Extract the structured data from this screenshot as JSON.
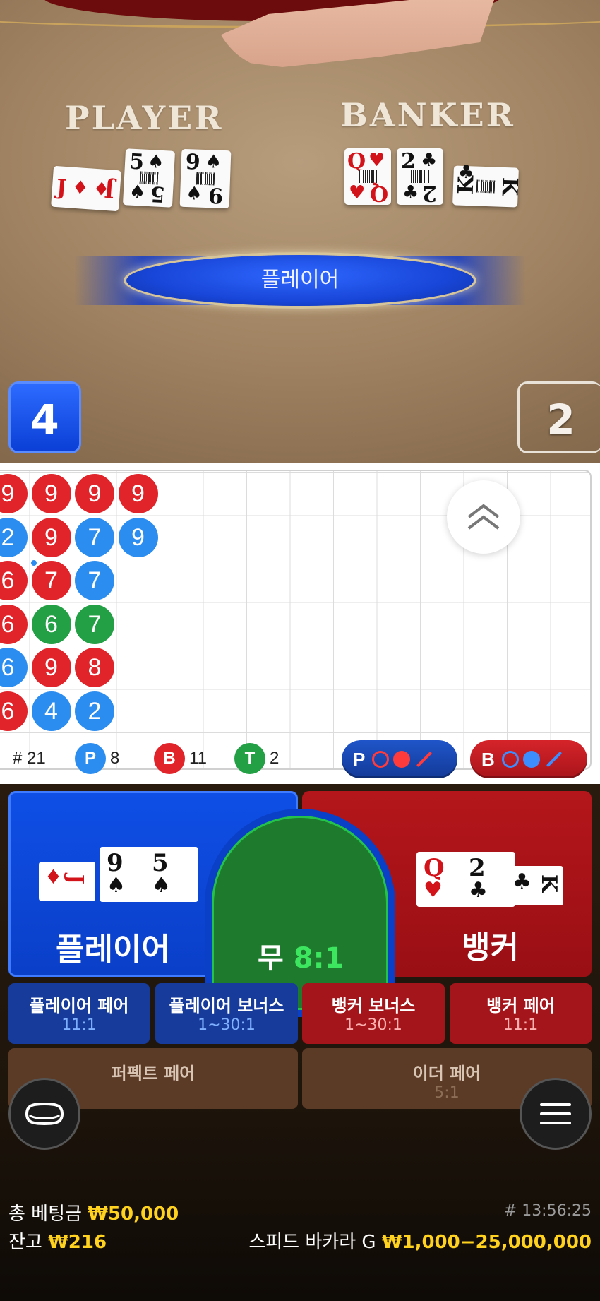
{
  "table": {
    "player_label": "PLAYER",
    "banker_label": "BANKER",
    "result_text": "플레이어",
    "player_score": "4",
    "banker_score": "2",
    "player_cards": [
      {
        "rank": "J",
        "suit": "♦",
        "color": "red"
      },
      {
        "rank": "5",
        "suit": "♠",
        "color": "black"
      },
      {
        "rank": "9",
        "suit": "♠",
        "color": "black"
      }
    ],
    "banker_cards": [
      {
        "rank": "Q",
        "suit": "♥",
        "color": "red"
      },
      {
        "rank": "2",
        "suit": "♣",
        "color": "black"
      },
      {
        "rank": "K",
        "suit": "♣",
        "color": "black"
      }
    ]
  },
  "roadmap": {
    "columns": [
      [
        {
          "v": "9",
          "c": "r"
        },
        {
          "v": "2",
          "c": "b"
        },
        {
          "v": "6",
          "c": "r"
        },
        {
          "v": "6",
          "c": "r"
        },
        {
          "v": "6",
          "c": "b"
        },
        {
          "v": "6",
          "c": "r"
        }
      ],
      [
        {
          "v": "9",
          "c": "r"
        },
        {
          "v": "9",
          "c": "r"
        },
        {
          "v": "7",
          "c": "r"
        },
        {
          "v": "6",
          "c": "g"
        },
        {
          "v": "9",
          "c": "r"
        },
        {
          "v": "4",
          "c": "b"
        }
      ],
      [
        {
          "v": "9",
          "c": "r"
        },
        {
          "v": "7",
          "c": "b"
        },
        {
          "v": "7",
          "c": "b"
        },
        {
          "v": "7",
          "c": "g"
        },
        {
          "v": "8",
          "c": "r"
        },
        {
          "v": "2",
          "c": "b"
        }
      ],
      [
        {
          "v": "9",
          "c": "r"
        },
        {
          "v": "9",
          "c": "b"
        }
      ]
    ],
    "stats": {
      "round_label": "# 21",
      "player_letter": "P",
      "player_count": "8",
      "banker_letter": "B",
      "banker_count": "11",
      "tie_letter": "T",
      "tie_count": "2"
    },
    "predict_player_letter": "P",
    "predict_banker_letter": "B"
  },
  "bets": {
    "player_label": "플레이어",
    "tie_label": "무",
    "tie_odds": "8:1",
    "banker_label": "뱅커",
    "player_cards": [
      {
        "rank": "J",
        "suit": "♦",
        "color": "red",
        "rotated": true
      },
      {
        "rank": "9",
        "suit": "♠",
        "color": "black"
      },
      {
        "rank": "5",
        "suit": "♠",
        "color": "black"
      }
    ],
    "banker_cards": [
      {
        "rank": "Q",
        "suit": "♥",
        "color": "red"
      },
      {
        "rank": "2",
        "suit": "♣",
        "color": "black"
      },
      {
        "rank": "K",
        "suit": "♣",
        "color": "black",
        "rotated": true
      }
    ],
    "side": [
      {
        "name": "플레이어 페어",
        "odds": "11:1"
      },
      {
        "name": "플레이어 보너스",
        "odds": "1~30:1"
      },
      {
        "name": "뱅커 보너스",
        "odds": "1~30:1"
      },
      {
        "name": "뱅커 페어",
        "odds": "11:1"
      },
      {
        "name": "퍼펙트 페어",
        "odds": ""
      },
      {
        "name": "이더 페어",
        "odds": "5:1"
      }
    ]
  },
  "footer": {
    "total_bet_label": "총 베팅금",
    "total_bet_value": "₩50,000",
    "balance_label": "잔고",
    "balance_value": "₩216",
    "round_id": "# 13:56:25",
    "table_name": "스피드 바카라 G",
    "limits": "₩1,000−25,000,000"
  },
  "colors": {
    "player_blue": "#0f4fe6",
    "banker_red": "#b4161b",
    "tie_green": "#1e7a2c",
    "accent_gold": "#ffd21f"
  },
  "icons": {
    "collapse": "double-chevron-up-icon",
    "table_view": "table-view-icon",
    "menu": "hamburger-menu-icon"
  }
}
